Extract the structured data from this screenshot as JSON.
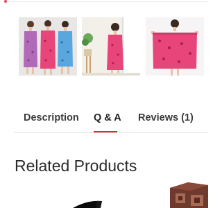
{
  "gallery": {
    "images": [
      {
        "alt": "Three women in pink, purple and blue wrap towel dresses"
      },
      {
        "alt": "Woman in pink wrap towel dress by window"
      },
      {
        "alt": "Woman holding pink towel wrap open"
      }
    ]
  },
  "tabs": [
    {
      "label": "Description",
      "active": false
    },
    {
      "label": "Q & A",
      "active": true
    },
    {
      "label": "Reviews (1)",
      "active": false
    }
  ],
  "related": {
    "title": "Related Products"
  },
  "colors": {
    "accent": "#e8232a",
    "towel_pink": "#e8457a",
    "towel_purple": "#b06ab8",
    "towel_blue": "#5aa7de"
  }
}
